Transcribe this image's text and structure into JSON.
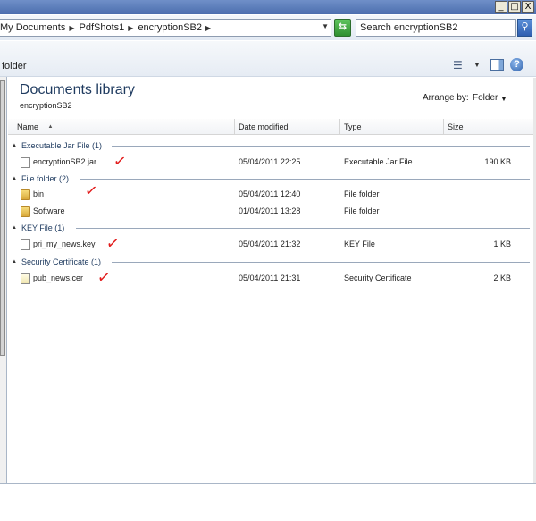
{
  "titlebar": {
    "minimize": "_",
    "maximize": "□",
    "close": "X"
  },
  "address": {
    "crumbs": [
      "My Documents",
      "PdfShots1",
      "encryptionSB2"
    ],
    "refresh_icon": "refresh-icon"
  },
  "search": {
    "placeholder": "Search encryptionSB2"
  },
  "toolbar": {
    "folder_label": "folder"
  },
  "library": {
    "title": "Documents library",
    "subtitle": "encryptionSB2",
    "arrange_label": "Arrange by:",
    "arrange_value": "Folder"
  },
  "columns": {
    "name": "Name",
    "date": "Date modified",
    "type": "Type",
    "size": "Size"
  },
  "groups": [
    {
      "label": "Executable Jar File (1)"
    },
    {
      "label": "File folder (2)"
    },
    {
      "label": "KEY File (1)"
    },
    {
      "label": "Security Certificate (1)"
    }
  ],
  "files": [
    {
      "name": "encryptionSB2.jar",
      "date": "05/04/2011 22:25",
      "type": "Executable Jar File",
      "size": "190 KB",
      "icon": "jar-file-icon"
    },
    {
      "name": "bin",
      "date": "05/04/2011 12:40",
      "type": "File folder",
      "size": "",
      "icon": "folder-icon"
    },
    {
      "name": "Software",
      "date": "01/04/2011 13:28",
      "type": "File folder",
      "size": "",
      "icon": "folder-icon"
    },
    {
      "name": "pri_my_news.key",
      "date": "05/04/2011 21:32",
      "type": "KEY File",
      "size": "1 KB",
      "icon": "key-file-icon"
    },
    {
      "name": "pub_news.cer",
      "date": "05/04/2011 21:31",
      "type": "Security Certificate",
      "size": "2 KB",
      "icon": "certificate-icon"
    }
  ],
  "annotations": {
    "check_mark": "✓"
  },
  "colors": {
    "check": "#e21b1b",
    "title_bar": "#4c6eae",
    "library_title": "#1e3a5f"
  }
}
